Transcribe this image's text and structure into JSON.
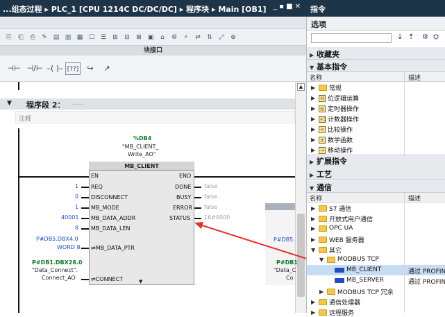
{
  "titlebar": {
    "text": "...组态过程 ▸ PLC_1 [CPU 1214C DC/DC/DC] ▸ 程序块 ▸ Main [OB1]",
    "buttons": "_ ▪ ■ ✕"
  },
  "instructions_pane": {
    "title": "指令",
    "options_label": "选项"
  },
  "toolbar": {
    "block_interface_label": "块接口"
  },
  "ladder_buttons": [
    "⊣⊢",
    "⊣/⊢",
    "–( )–",
    "[??]",
    "↪",
    "↗"
  ],
  "network": {
    "title": "程序段 2：",
    "title_suffix": "......",
    "comment": "注释",
    "db_tag": "%DB4",
    "db_name_line1": "\"MB_CLIENT_",
    "db_name_line2": "Write_AO\"",
    "block_name": "MB_CLIENT",
    "inputs": [
      {
        "name": "EN",
        "value": ""
      },
      {
        "name": "REQ",
        "value": "1"
      },
      {
        "name": "DISCONNECT",
        "value": "0"
      },
      {
        "name": "MB_MODE",
        "value": "1"
      },
      {
        "name": "MB_DATA_ADDR",
        "value": "40001"
      },
      {
        "name": "MB_DATA_LEN",
        "value": "8"
      },
      {
        "name": "MB_DATA_PTR",
        "value_line1": "P#DB5.DBX4.0",
        "value_line2": "WORD 8"
      },
      {
        "name": "CONNECT",
        "value_line1": "P#DB1.DBX28.0",
        "value_line2": "\"Data_Connect\".",
        "value_line3": "Connect_AO"
      }
    ],
    "outputs": [
      {
        "name": "ENO",
        "value": ""
      },
      {
        "name": "DONE",
        "value": "false"
      },
      {
        "name": "BUSY",
        "value": "false"
      },
      {
        "name": "ERROR",
        "value": "false"
      },
      {
        "name": "STATUS",
        "value": "16#0000"
      }
    ],
    "second_block_partial": {
      "ptr_text": "P#DB5.",
      "connect_line1": "P#DB1",
      "connect_line2": "\"Data_C",
      "connect_line3": "Co"
    }
  },
  "right_pane": {
    "sections": [
      {
        "label": "收藏夹",
        "expanded": false
      },
      {
        "label": "基本指令",
        "expanded": true
      },
      {
        "label": "扩展指令",
        "expanded": false
      },
      {
        "label": "工艺",
        "expanded": false
      },
      {
        "label": "通信",
        "expanded": true
      }
    ],
    "columns": {
      "name": "名称",
      "desc": "描述"
    },
    "basic_items": [
      {
        "icon": "",
        "label": "常规"
      },
      {
        "icon": "H",
        "label": "位逻辑运算"
      },
      {
        "icon": "◎",
        "label": "定时器操作"
      },
      {
        "icon": "+1",
        "label": "计数器操作"
      },
      {
        "icon": "<",
        "label": "比较操作"
      },
      {
        "icon": "±",
        "label": "数学函数"
      },
      {
        "icon": "→",
        "label": "移动操作"
      }
    ],
    "comm_items": [
      {
        "label": "S7 通信",
        "desc": ""
      },
      {
        "label": "开放式用户通信",
        "desc": ""
      },
      {
        "label": "OPC UA",
        "desc": ""
      },
      {
        "label": "WEB 服务器",
        "desc": ""
      },
      {
        "label": "其它",
        "desc": ""
      },
      {
        "label": "MODBUS TCP",
        "desc": ""
      },
      {
        "label": "MB_CLIENT",
        "desc": "通过 PROFIN"
      },
      {
        "label": "MB_SERVER",
        "desc": "通过 PROFIN"
      },
      {
        "label": "MODBUS TCP 冗余",
        "desc": ""
      },
      {
        "label": "通信处理器",
        "desc": ""
      },
      {
        "label": "远程服务",
        "desc": ""
      }
    ]
  }
}
